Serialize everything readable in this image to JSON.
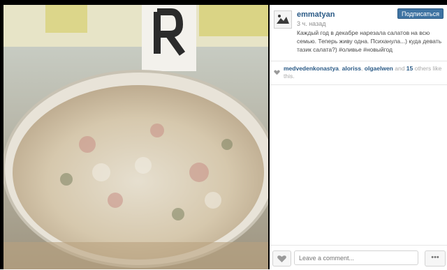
{
  "post": {
    "photo_icon": "photo-salad-bowl",
    "user": {
      "username": "emmatyan",
      "time_ago": "3 ч. назад",
      "avatar_icon": "avatar"
    },
    "follow_label": "Подписаться",
    "caption": "Каждый год в декабре нарезала салатов на всю семью. Теперь живу одна. Психанула...) куда девать тазик салата?) #оливье #новыйгод",
    "likes": {
      "users": [
        "medvedenkonastya",
        "aloriss",
        "olgaelwen"
      ],
      "sep1": ", ",
      "sep2": ", ",
      "and_text": " and ",
      "others_count": "15",
      "others_text": " others like this."
    },
    "comment_placeholder": "Leave a comment...",
    "more_label": "•••"
  },
  "colors": {
    "link": "#2a5a86",
    "button": "#3e73a2",
    "muted": "#a9a9a9"
  }
}
